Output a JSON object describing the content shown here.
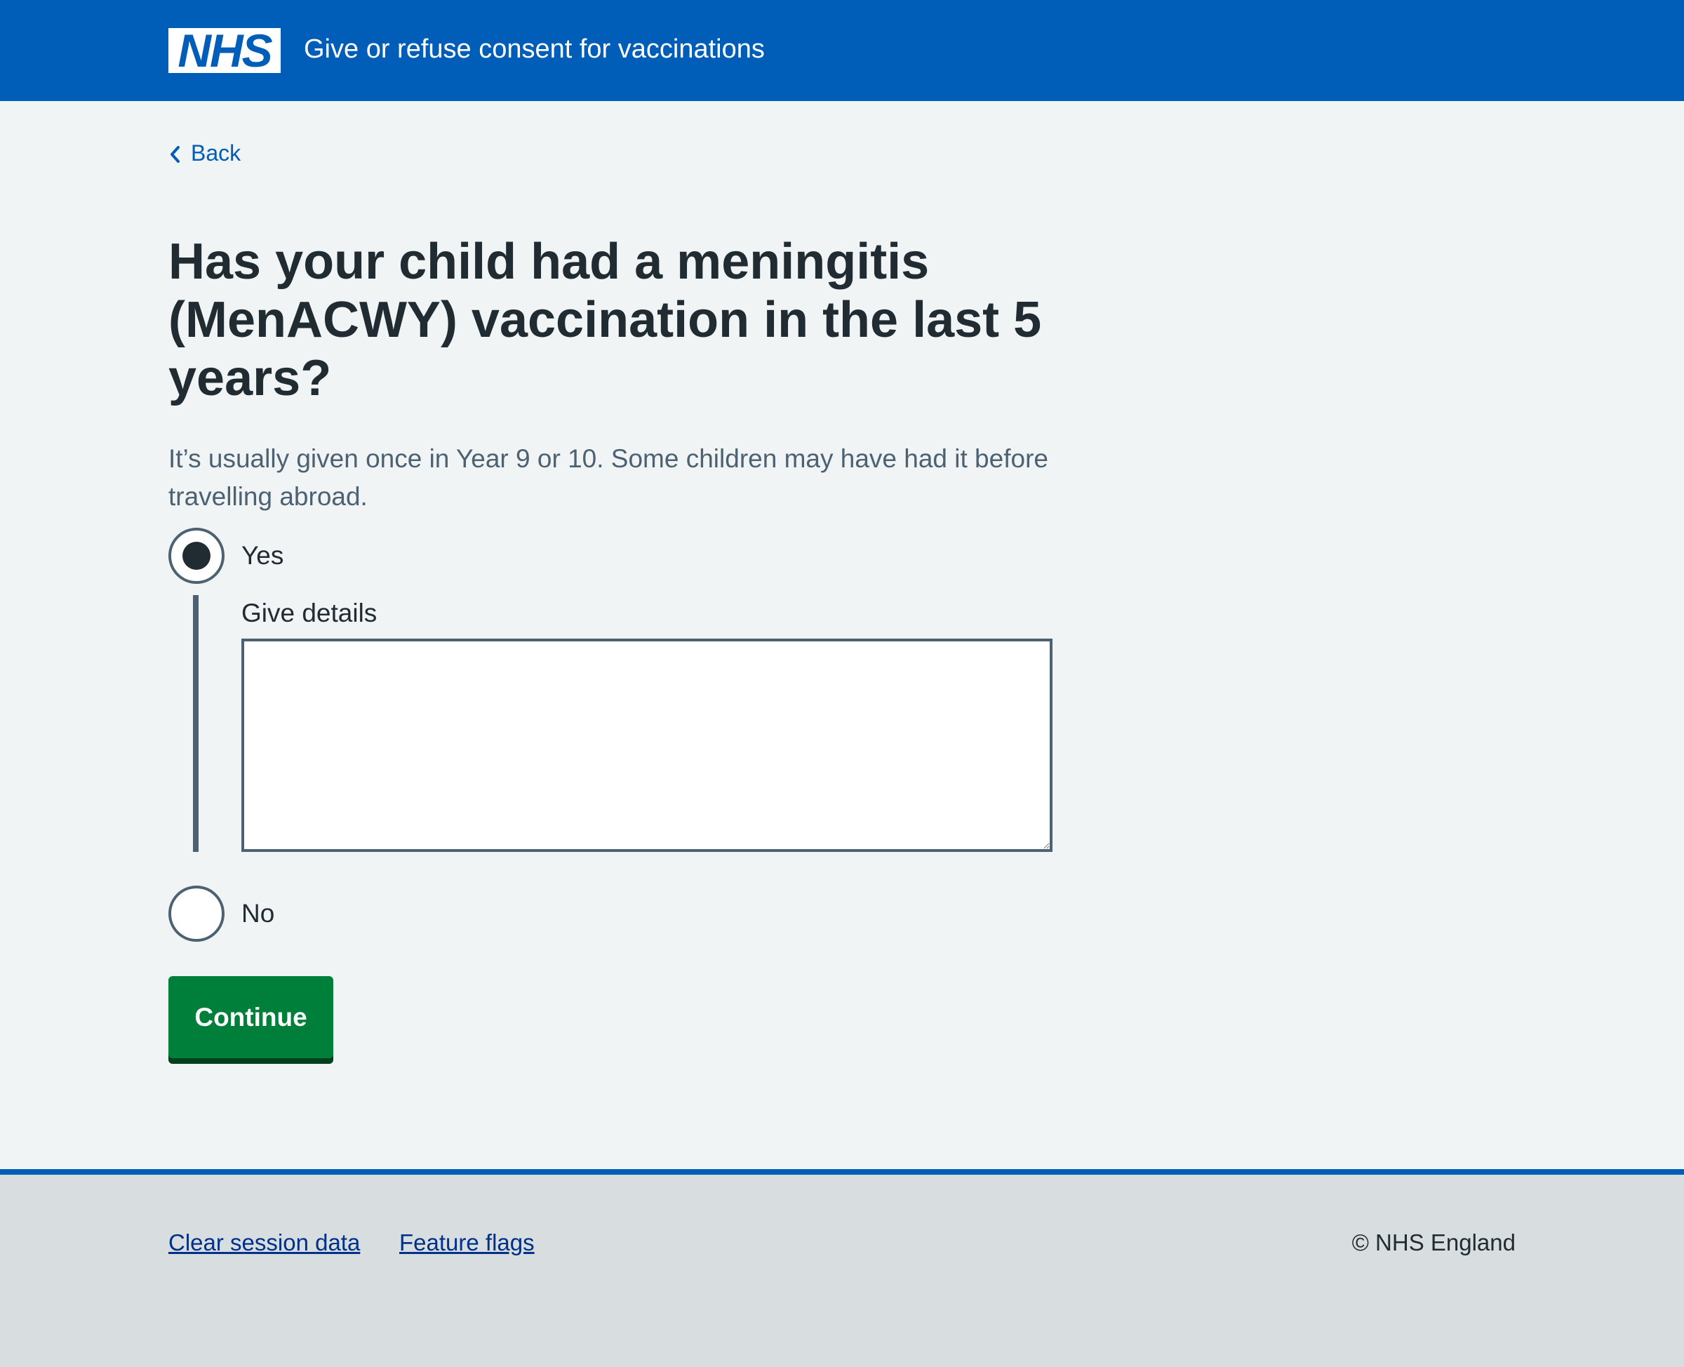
{
  "header": {
    "logo_text": "NHS",
    "service_name": "Give or refuse consent for vaccinations",
    "background_color": "#005eb8"
  },
  "navigation": {
    "back_label": "Back",
    "back_icon": "chevron-left-icon"
  },
  "question": {
    "heading": "Has your child had a meningitis (MenACWY) vaccination in the last 5 years?",
    "hint": "It’s usually given once in Year 9 or 10. Some children may have had it before travelling abroad.",
    "options": [
      {
        "label": "Yes",
        "selected": true
      },
      {
        "label": "No",
        "selected": false
      }
    ],
    "details_label": "Give details",
    "details_value": ""
  },
  "actions": {
    "continue_label": "Continue",
    "continue_color": "#007f3b"
  },
  "footer": {
    "links": [
      "Clear session data",
      "Feature flags"
    ],
    "copyright": "© NHS England"
  }
}
